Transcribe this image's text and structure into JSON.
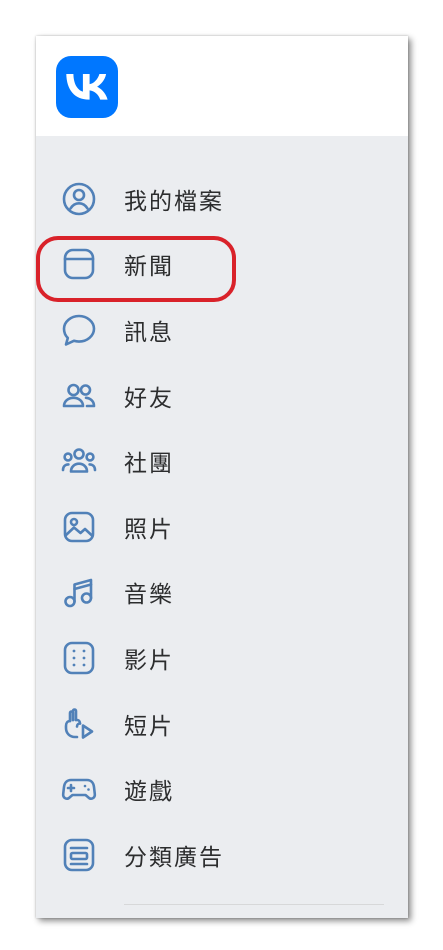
{
  "brand": {
    "logo_text": "VK",
    "accent": "#0077ff"
  },
  "nav": {
    "icon_color": "#5181b8",
    "highlight_color": "#d9222a",
    "items": [
      {
        "label": "我的檔案",
        "icon": "profile-icon"
      },
      {
        "label": "新聞",
        "icon": "news-icon"
      },
      {
        "label": "訊息",
        "icon": "messages-icon"
      },
      {
        "label": "好友",
        "icon": "friends-icon",
        "highlighted": true
      },
      {
        "label": "社團",
        "icon": "communities-icon"
      },
      {
        "label": "照片",
        "icon": "photos-icon"
      },
      {
        "label": "音樂",
        "icon": "music-icon"
      },
      {
        "label": "影片",
        "icon": "video-icon"
      },
      {
        "label": "短片",
        "icon": "clips-icon"
      },
      {
        "label": "遊戲",
        "icon": "games-icon"
      },
      {
        "label": "分類廣告",
        "icon": "classifieds-icon"
      }
    ]
  }
}
